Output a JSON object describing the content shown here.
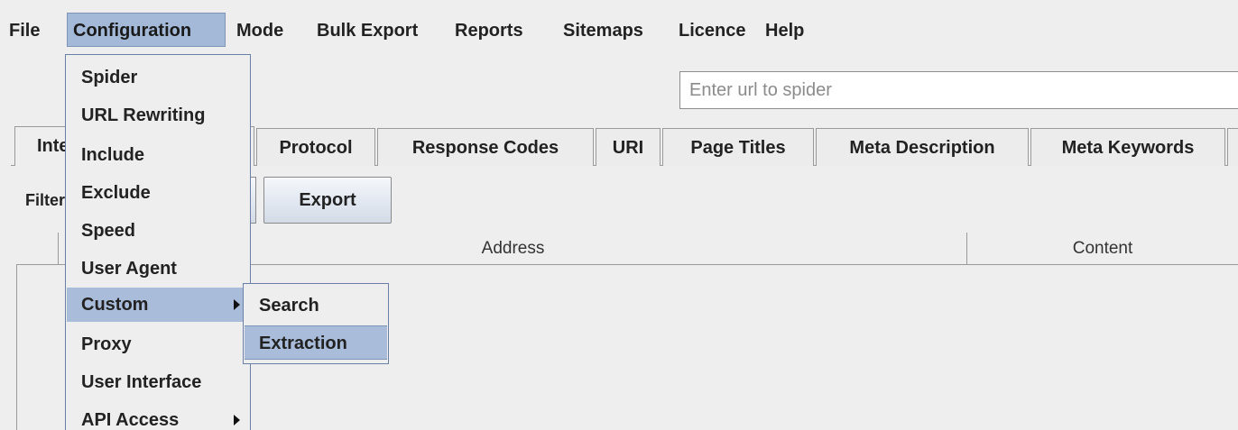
{
  "menubar": {
    "items": [
      {
        "label": "File"
      },
      {
        "label": "Configuration"
      },
      {
        "label": "Mode"
      },
      {
        "label": "Bulk Export"
      },
      {
        "label": "Reports"
      },
      {
        "label": "Sitemaps"
      },
      {
        "label": "Licence"
      },
      {
        "label": "Help"
      }
    ]
  },
  "url_field": {
    "placeholder": "Enter url to spider"
  },
  "tabs": [
    {
      "label": "Internal"
    },
    {
      "label": "Protocol"
    },
    {
      "label": "Response Codes"
    },
    {
      "label": "URI"
    },
    {
      "label": "Page Titles"
    },
    {
      "label": "Meta Description"
    },
    {
      "label": "Meta Keywords"
    }
  ],
  "filter": {
    "label": "Filter"
  },
  "export_button": {
    "label": "Export"
  },
  "table": {
    "columns": [
      {
        "label": "Address"
      },
      {
        "label": "Content"
      }
    ]
  },
  "configuration_menu": {
    "items": [
      {
        "label": "Spider"
      },
      {
        "label": "URL Rewriting"
      },
      {
        "label": "Include"
      },
      {
        "label": "Exclude"
      },
      {
        "label": "Speed"
      },
      {
        "label": "User Agent"
      },
      {
        "label": "Custom",
        "submenu": true,
        "highlighted": true
      },
      {
        "label": "Proxy"
      },
      {
        "label": "User Interface"
      },
      {
        "label": "API Access",
        "submenu": true
      }
    ]
  },
  "custom_submenu": {
    "items": [
      {
        "label": "Search"
      },
      {
        "label": "Extraction",
        "highlighted": true
      }
    ]
  },
  "colors": {
    "background": "#eeeeee",
    "menu_highlight": "#a9bcd9",
    "border": "#9a9a9a"
  }
}
